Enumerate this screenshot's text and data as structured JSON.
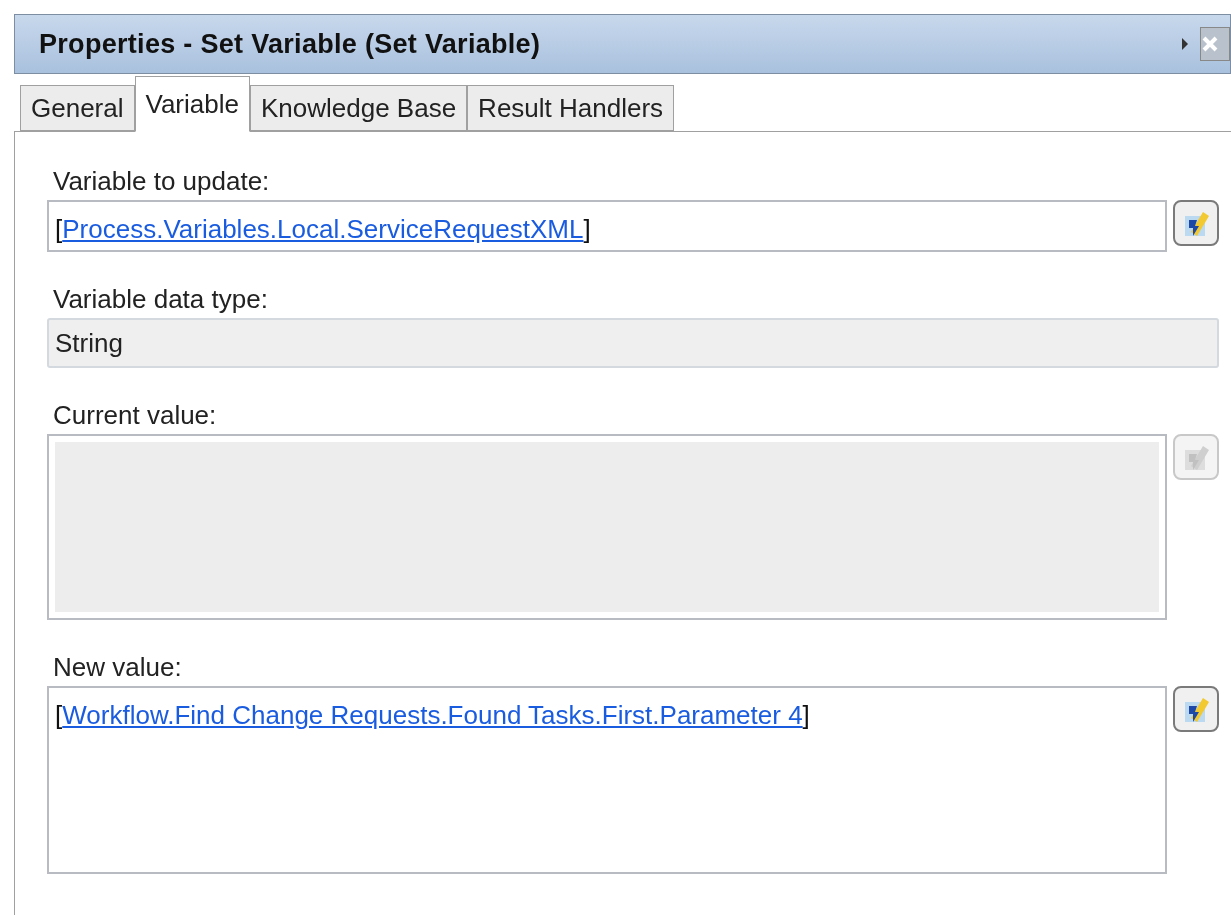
{
  "window": {
    "title": "Properties - Set Variable (Set Variable)"
  },
  "tabs": [
    {
      "label": "General",
      "selected": false
    },
    {
      "label": "Variable",
      "selected": true
    },
    {
      "label": "Knowledge Base",
      "selected": false
    },
    {
      "label": "Result Handlers",
      "selected": false
    }
  ],
  "fields": [
    {
      "kind": "link",
      "label": "Variable to update:",
      "open": "[",
      "link": "Process.Variables.Local.ServiceRequestXML",
      "close": "]",
      "multiline": false,
      "picker_disabled": false
    },
    {
      "kind": "readonly",
      "label": "Variable data type:",
      "value": "String"
    },
    {
      "kind": "empty",
      "label": "Current value:",
      "multiline": true,
      "picker_disabled": true
    },
    {
      "kind": "link",
      "label": "New value:",
      "open": "[",
      "link": "Workflow.Find Change Requests.Found Tasks.First.Parameter 4",
      "close": "]",
      "multiline": true,
      "picker_disabled": false
    }
  ]
}
